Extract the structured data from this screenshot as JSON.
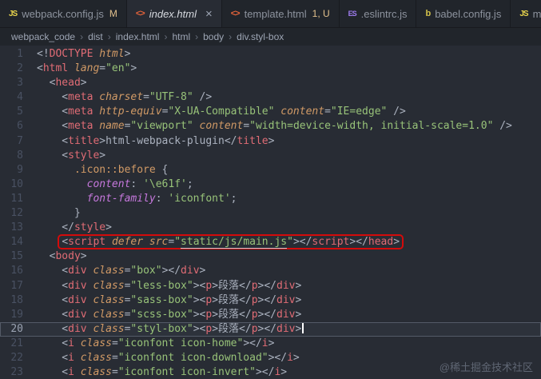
{
  "tabs": [
    {
      "name": "webpack.config.js",
      "icon": "js",
      "badge": "M",
      "active": false,
      "italic": false
    },
    {
      "name": "index.html",
      "icon": "html",
      "close": true,
      "active": true,
      "italic": true
    },
    {
      "name": "template.html",
      "icon": "html",
      "badge": "1, U",
      "active": false,
      "italic": false
    },
    {
      "name": ".eslintrc.js",
      "icon": "eslint",
      "active": false,
      "italic": false
    },
    {
      "name": "babel.config.js",
      "icon": "babel",
      "active": false,
      "italic": false
    },
    {
      "name": "main.js",
      "icon": "js",
      "active": false,
      "italic": false
    }
  ],
  "icons": {
    "js": "JS",
    "html": "<>",
    "eslint": "ES",
    "babel": "b"
  },
  "breadcrumb": {
    "items": [
      "webpack_code",
      "dist",
      "index.html",
      "html",
      "body",
      "div.styl-box"
    ],
    "separator": "›"
  },
  "code": {
    "lines": [
      {
        "num": 1,
        "tokens": [
          {
            "t": "p",
            "s": "<!"
          },
          {
            "t": "tag",
            "s": "DOCTYPE"
          },
          {
            "t": "attr",
            "s": " html"
          },
          {
            "t": "p",
            "s": ">"
          }
        ]
      },
      {
        "num": 2,
        "tokens": [
          {
            "t": "p",
            "s": "<"
          },
          {
            "t": "tag",
            "s": "html"
          },
          {
            "t": "p",
            "s": " "
          },
          {
            "t": "attr",
            "s": "lang"
          },
          {
            "t": "p",
            "s": "="
          },
          {
            "t": "str",
            "s": "\"en\""
          },
          {
            "t": "p",
            "s": ">"
          }
        ]
      },
      {
        "num": 3,
        "tokens": [
          {
            "t": "p",
            "s": "  <"
          },
          {
            "t": "tag",
            "s": "head"
          },
          {
            "t": "p",
            "s": ">"
          }
        ]
      },
      {
        "num": 4,
        "tokens": [
          {
            "t": "p",
            "s": "    <"
          },
          {
            "t": "tag",
            "s": "meta"
          },
          {
            "t": "p",
            "s": " "
          },
          {
            "t": "attr",
            "s": "charset"
          },
          {
            "t": "p",
            "s": "="
          },
          {
            "t": "str",
            "s": "\"UTF-8\""
          },
          {
            "t": "p",
            "s": " />"
          }
        ]
      },
      {
        "num": 5,
        "tokens": [
          {
            "t": "p",
            "s": "    <"
          },
          {
            "t": "tag",
            "s": "meta"
          },
          {
            "t": "p",
            "s": " "
          },
          {
            "t": "attr",
            "s": "http-equiv"
          },
          {
            "t": "p",
            "s": "="
          },
          {
            "t": "str",
            "s": "\"X-UA-Compatible\""
          },
          {
            "t": "p",
            "s": " "
          },
          {
            "t": "attr",
            "s": "content"
          },
          {
            "t": "p",
            "s": "="
          },
          {
            "t": "str",
            "s": "\"IE=edge\""
          },
          {
            "t": "p",
            "s": " />"
          }
        ]
      },
      {
        "num": 6,
        "tokens": [
          {
            "t": "p",
            "s": "    <"
          },
          {
            "t": "tag",
            "s": "meta"
          },
          {
            "t": "p",
            "s": " "
          },
          {
            "t": "attr",
            "s": "name"
          },
          {
            "t": "p",
            "s": "="
          },
          {
            "t": "str",
            "s": "\"viewport\""
          },
          {
            "t": "p",
            "s": " "
          },
          {
            "t": "attr",
            "s": "content"
          },
          {
            "t": "p",
            "s": "="
          },
          {
            "t": "str",
            "s": "\"width=device-width, initial-scale=1.0\""
          },
          {
            "t": "p",
            "s": " />"
          }
        ]
      },
      {
        "num": 7,
        "tokens": [
          {
            "t": "p",
            "s": "    <"
          },
          {
            "t": "tag",
            "s": "title"
          },
          {
            "t": "p",
            "s": ">"
          },
          {
            "t": "text",
            "s": "html-webpack-plugin"
          },
          {
            "t": "p",
            "s": "</"
          },
          {
            "t": "tag",
            "s": "title"
          },
          {
            "t": "p",
            "s": ">"
          }
        ]
      },
      {
        "num": 8,
        "tokens": [
          {
            "t": "p",
            "s": "    <"
          },
          {
            "t": "tag",
            "s": "style"
          },
          {
            "t": "p",
            "s": ">"
          }
        ]
      },
      {
        "num": 9,
        "tokens": [
          {
            "t": "sel",
            "s": "      .icon::before"
          },
          {
            "t": "p",
            "s": " {"
          }
        ]
      },
      {
        "num": 10,
        "tokens": [
          {
            "t": "prop",
            "s": "        content"
          },
          {
            "t": "p",
            "s": ": "
          },
          {
            "t": "str",
            "s": "'\\e61f'"
          },
          {
            "t": "p",
            "s": ";"
          }
        ]
      },
      {
        "num": 11,
        "tokens": [
          {
            "t": "prop",
            "s": "        font-family"
          },
          {
            "t": "p",
            "s": ": "
          },
          {
            "t": "str",
            "s": "'iconfont'"
          },
          {
            "t": "p",
            "s": ";"
          }
        ]
      },
      {
        "num": 12,
        "tokens": [
          {
            "t": "p",
            "s": "      }"
          }
        ]
      },
      {
        "num": 13,
        "tokens": [
          {
            "t": "p",
            "s": "    </"
          },
          {
            "t": "tag",
            "s": "style"
          },
          {
            "t": "p",
            "s": ">"
          }
        ]
      },
      {
        "num": 14,
        "boxed": true,
        "tokens": [
          {
            "t": "p",
            "s": "    "
          },
          {
            "t": "p",
            "s": "<"
          },
          {
            "t": "tag",
            "s": "script"
          },
          {
            "t": "p",
            "s": " "
          },
          {
            "t": "attr",
            "s": "defer"
          },
          {
            "t": "p",
            "s": " "
          },
          {
            "t": "attr",
            "s": "src"
          },
          {
            "t": "p",
            "s": "="
          },
          {
            "t": "str",
            "s": "\""
          },
          {
            "t": "link",
            "s": "static/js/main.js"
          },
          {
            "t": "str",
            "s": "\""
          },
          {
            "t": "p",
            "s": "></"
          },
          {
            "t": "tag",
            "s": "script"
          },
          {
            "t": "p",
            "s": "></"
          },
          {
            "t": "tag",
            "s": "head"
          },
          {
            "t": "p",
            "s": ">"
          }
        ]
      },
      {
        "num": 15,
        "tokens": [
          {
            "t": "p",
            "s": "  <"
          },
          {
            "t": "tag",
            "s": "body"
          },
          {
            "t": "p",
            "s": ">"
          }
        ]
      },
      {
        "num": 16,
        "tokens": [
          {
            "t": "p",
            "s": "    <"
          },
          {
            "t": "tag",
            "s": "div"
          },
          {
            "t": "p",
            "s": " "
          },
          {
            "t": "attr",
            "s": "class"
          },
          {
            "t": "p",
            "s": "="
          },
          {
            "t": "str",
            "s": "\"box\""
          },
          {
            "t": "p",
            "s": "></"
          },
          {
            "t": "tag",
            "s": "div"
          },
          {
            "t": "p",
            "s": ">"
          }
        ]
      },
      {
        "num": 17,
        "tokens": [
          {
            "t": "p",
            "s": "    <"
          },
          {
            "t": "tag",
            "s": "div"
          },
          {
            "t": "p",
            "s": " "
          },
          {
            "t": "attr",
            "s": "class"
          },
          {
            "t": "p",
            "s": "="
          },
          {
            "t": "str",
            "s": "\"less-box\""
          },
          {
            "t": "p",
            "s": "><"
          },
          {
            "t": "tag",
            "s": "p"
          },
          {
            "t": "p",
            "s": ">"
          },
          {
            "t": "text",
            "s": "段落"
          },
          {
            "t": "p",
            "s": "</"
          },
          {
            "t": "tag",
            "s": "p"
          },
          {
            "t": "p",
            "s": "></"
          },
          {
            "t": "tag",
            "s": "div"
          },
          {
            "t": "p",
            "s": ">"
          }
        ]
      },
      {
        "num": 18,
        "tokens": [
          {
            "t": "p",
            "s": "    <"
          },
          {
            "t": "tag",
            "s": "div"
          },
          {
            "t": "p",
            "s": " "
          },
          {
            "t": "attr",
            "s": "class"
          },
          {
            "t": "p",
            "s": "="
          },
          {
            "t": "str",
            "s": "\"sass-box\""
          },
          {
            "t": "p",
            "s": "><"
          },
          {
            "t": "tag",
            "s": "p"
          },
          {
            "t": "p",
            "s": ">"
          },
          {
            "t": "text",
            "s": "段落"
          },
          {
            "t": "p",
            "s": "</"
          },
          {
            "t": "tag",
            "s": "p"
          },
          {
            "t": "p",
            "s": "></"
          },
          {
            "t": "tag",
            "s": "div"
          },
          {
            "t": "p",
            "s": ">"
          }
        ]
      },
      {
        "num": 19,
        "tokens": [
          {
            "t": "p",
            "s": "    <"
          },
          {
            "t": "tag",
            "s": "div"
          },
          {
            "t": "p",
            "s": " "
          },
          {
            "t": "attr",
            "s": "class"
          },
          {
            "t": "p",
            "s": "="
          },
          {
            "t": "str",
            "s": "\"scss-box\""
          },
          {
            "t": "p",
            "s": "><"
          },
          {
            "t": "tag",
            "s": "p"
          },
          {
            "t": "p",
            "s": ">"
          },
          {
            "t": "text",
            "s": "段落"
          },
          {
            "t": "p",
            "s": "</"
          },
          {
            "t": "tag",
            "s": "p"
          },
          {
            "t": "p",
            "s": "></"
          },
          {
            "t": "tag",
            "s": "div"
          },
          {
            "t": "p",
            "s": ">"
          }
        ]
      },
      {
        "num": 20,
        "current": true,
        "cursor": true,
        "tokens": [
          {
            "t": "p",
            "s": "    <"
          },
          {
            "t": "tag",
            "s": "div"
          },
          {
            "t": "p",
            "s": " "
          },
          {
            "t": "attr",
            "s": "class"
          },
          {
            "t": "p",
            "s": "="
          },
          {
            "t": "str",
            "s": "\"styl-box\""
          },
          {
            "t": "p",
            "s": "><"
          },
          {
            "t": "tag",
            "s": "p"
          },
          {
            "t": "p",
            "s": ">"
          },
          {
            "t": "text",
            "s": "段落"
          },
          {
            "t": "p",
            "s": "</"
          },
          {
            "t": "tag",
            "s": "p"
          },
          {
            "t": "p",
            "s": "></"
          },
          {
            "t": "tag",
            "s": "div"
          },
          {
            "t": "p",
            "s": ">"
          }
        ]
      },
      {
        "num": 21,
        "tokens": [
          {
            "t": "p",
            "s": "    <"
          },
          {
            "t": "tag",
            "s": "i"
          },
          {
            "t": "p",
            "s": " "
          },
          {
            "t": "attr",
            "s": "class"
          },
          {
            "t": "p",
            "s": "="
          },
          {
            "t": "str",
            "s": "\"iconfont icon-home\""
          },
          {
            "t": "p",
            "s": "></"
          },
          {
            "t": "tag",
            "s": "i"
          },
          {
            "t": "p",
            "s": ">"
          }
        ]
      },
      {
        "num": 22,
        "tokens": [
          {
            "t": "p",
            "s": "    <"
          },
          {
            "t": "tag",
            "s": "i"
          },
          {
            "t": "p",
            "s": " "
          },
          {
            "t": "attr",
            "s": "class"
          },
          {
            "t": "p",
            "s": "="
          },
          {
            "t": "str",
            "s": "\"iconfont icon-download\""
          },
          {
            "t": "p",
            "s": "></"
          },
          {
            "t": "tag",
            "s": "i"
          },
          {
            "t": "p",
            "s": ">"
          }
        ]
      },
      {
        "num": 23,
        "tokens": [
          {
            "t": "p",
            "s": "    <"
          },
          {
            "t": "tag",
            "s": "i"
          },
          {
            "t": "p",
            "s": " "
          },
          {
            "t": "attr",
            "s": "class"
          },
          {
            "t": "p",
            "s": "="
          },
          {
            "t": "str",
            "s": "\"iconfont icon-invert\""
          },
          {
            "t": "p",
            "s": "></"
          },
          {
            "t": "tag",
            "s": "i"
          },
          {
            "t": "p",
            "s": ">"
          }
        ]
      }
    ]
  },
  "watermark": "@稀土掘金技术社区",
  "colors": {
    "editor_background": "#282c34",
    "tabbar_background": "#21252b",
    "tag": "#e06c75",
    "attribute": "#d19a66",
    "string": "#98c379",
    "property": "#c678dd",
    "punctuation": "#abb2bf",
    "line_number": "#495162",
    "annotation_box": "#d40b0b",
    "git_badge": "#e2c08d"
  }
}
